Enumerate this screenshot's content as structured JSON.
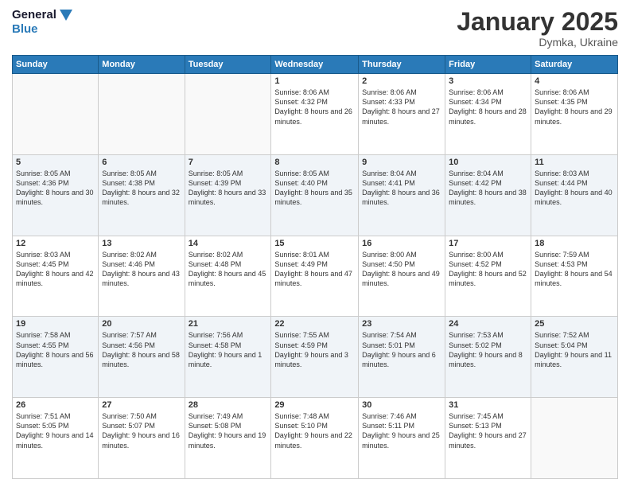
{
  "logo": {
    "line1": "General",
    "line2": "Blue"
  },
  "header": {
    "month": "January 2025",
    "location": "Dymka, Ukraine"
  },
  "days_of_week": [
    "Sunday",
    "Monday",
    "Tuesday",
    "Wednesday",
    "Thursday",
    "Friday",
    "Saturday"
  ],
  "weeks": [
    [
      {
        "day": "",
        "sunrise": "",
        "sunset": "",
        "daylight": ""
      },
      {
        "day": "",
        "sunrise": "",
        "sunset": "",
        "daylight": ""
      },
      {
        "day": "",
        "sunrise": "",
        "sunset": "",
        "daylight": ""
      },
      {
        "day": "1",
        "sunrise": "Sunrise: 8:06 AM",
        "sunset": "Sunset: 4:32 PM",
        "daylight": "Daylight: 8 hours and 26 minutes."
      },
      {
        "day": "2",
        "sunrise": "Sunrise: 8:06 AM",
        "sunset": "Sunset: 4:33 PM",
        "daylight": "Daylight: 8 hours and 27 minutes."
      },
      {
        "day": "3",
        "sunrise": "Sunrise: 8:06 AM",
        "sunset": "Sunset: 4:34 PM",
        "daylight": "Daylight: 8 hours and 28 minutes."
      },
      {
        "day": "4",
        "sunrise": "Sunrise: 8:06 AM",
        "sunset": "Sunset: 4:35 PM",
        "daylight": "Daylight: 8 hours and 29 minutes."
      }
    ],
    [
      {
        "day": "5",
        "sunrise": "Sunrise: 8:05 AM",
        "sunset": "Sunset: 4:36 PM",
        "daylight": "Daylight: 8 hours and 30 minutes."
      },
      {
        "day": "6",
        "sunrise": "Sunrise: 8:05 AM",
        "sunset": "Sunset: 4:38 PM",
        "daylight": "Daylight: 8 hours and 32 minutes."
      },
      {
        "day": "7",
        "sunrise": "Sunrise: 8:05 AM",
        "sunset": "Sunset: 4:39 PM",
        "daylight": "Daylight: 8 hours and 33 minutes."
      },
      {
        "day": "8",
        "sunrise": "Sunrise: 8:05 AM",
        "sunset": "Sunset: 4:40 PM",
        "daylight": "Daylight: 8 hours and 35 minutes."
      },
      {
        "day": "9",
        "sunrise": "Sunrise: 8:04 AM",
        "sunset": "Sunset: 4:41 PM",
        "daylight": "Daylight: 8 hours and 36 minutes."
      },
      {
        "day": "10",
        "sunrise": "Sunrise: 8:04 AM",
        "sunset": "Sunset: 4:42 PM",
        "daylight": "Daylight: 8 hours and 38 minutes."
      },
      {
        "day": "11",
        "sunrise": "Sunrise: 8:03 AM",
        "sunset": "Sunset: 4:44 PM",
        "daylight": "Daylight: 8 hours and 40 minutes."
      }
    ],
    [
      {
        "day": "12",
        "sunrise": "Sunrise: 8:03 AM",
        "sunset": "Sunset: 4:45 PM",
        "daylight": "Daylight: 8 hours and 42 minutes."
      },
      {
        "day": "13",
        "sunrise": "Sunrise: 8:02 AM",
        "sunset": "Sunset: 4:46 PM",
        "daylight": "Daylight: 8 hours and 43 minutes."
      },
      {
        "day": "14",
        "sunrise": "Sunrise: 8:02 AM",
        "sunset": "Sunset: 4:48 PM",
        "daylight": "Daylight: 8 hours and 45 minutes."
      },
      {
        "day": "15",
        "sunrise": "Sunrise: 8:01 AM",
        "sunset": "Sunset: 4:49 PM",
        "daylight": "Daylight: 8 hours and 47 minutes."
      },
      {
        "day": "16",
        "sunrise": "Sunrise: 8:00 AM",
        "sunset": "Sunset: 4:50 PM",
        "daylight": "Daylight: 8 hours and 49 minutes."
      },
      {
        "day": "17",
        "sunrise": "Sunrise: 8:00 AM",
        "sunset": "Sunset: 4:52 PM",
        "daylight": "Daylight: 8 hours and 52 minutes."
      },
      {
        "day": "18",
        "sunrise": "Sunrise: 7:59 AM",
        "sunset": "Sunset: 4:53 PM",
        "daylight": "Daylight: 8 hours and 54 minutes."
      }
    ],
    [
      {
        "day": "19",
        "sunrise": "Sunrise: 7:58 AM",
        "sunset": "Sunset: 4:55 PM",
        "daylight": "Daylight: 8 hours and 56 minutes."
      },
      {
        "day": "20",
        "sunrise": "Sunrise: 7:57 AM",
        "sunset": "Sunset: 4:56 PM",
        "daylight": "Daylight: 8 hours and 58 minutes."
      },
      {
        "day": "21",
        "sunrise": "Sunrise: 7:56 AM",
        "sunset": "Sunset: 4:58 PM",
        "daylight": "Daylight: 9 hours and 1 minute."
      },
      {
        "day": "22",
        "sunrise": "Sunrise: 7:55 AM",
        "sunset": "Sunset: 4:59 PM",
        "daylight": "Daylight: 9 hours and 3 minutes."
      },
      {
        "day": "23",
        "sunrise": "Sunrise: 7:54 AM",
        "sunset": "Sunset: 5:01 PM",
        "daylight": "Daylight: 9 hours and 6 minutes."
      },
      {
        "day": "24",
        "sunrise": "Sunrise: 7:53 AM",
        "sunset": "Sunset: 5:02 PM",
        "daylight": "Daylight: 9 hours and 8 minutes."
      },
      {
        "day": "25",
        "sunrise": "Sunrise: 7:52 AM",
        "sunset": "Sunset: 5:04 PM",
        "daylight": "Daylight: 9 hours and 11 minutes."
      }
    ],
    [
      {
        "day": "26",
        "sunrise": "Sunrise: 7:51 AM",
        "sunset": "Sunset: 5:05 PM",
        "daylight": "Daylight: 9 hours and 14 minutes."
      },
      {
        "day": "27",
        "sunrise": "Sunrise: 7:50 AM",
        "sunset": "Sunset: 5:07 PM",
        "daylight": "Daylight: 9 hours and 16 minutes."
      },
      {
        "day": "28",
        "sunrise": "Sunrise: 7:49 AM",
        "sunset": "Sunset: 5:08 PM",
        "daylight": "Daylight: 9 hours and 19 minutes."
      },
      {
        "day": "29",
        "sunrise": "Sunrise: 7:48 AM",
        "sunset": "Sunset: 5:10 PM",
        "daylight": "Daylight: 9 hours and 22 minutes."
      },
      {
        "day": "30",
        "sunrise": "Sunrise: 7:46 AM",
        "sunset": "Sunset: 5:11 PM",
        "daylight": "Daylight: 9 hours and 25 minutes."
      },
      {
        "day": "31",
        "sunrise": "Sunrise: 7:45 AM",
        "sunset": "Sunset: 5:13 PM",
        "daylight": "Daylight: 9 hours and 27 minutes."
      },
      {
        "day": "",
        "sunrise": "",
        "sunset": "",
        "daylight": ""
      }
    ]
  ]
}
